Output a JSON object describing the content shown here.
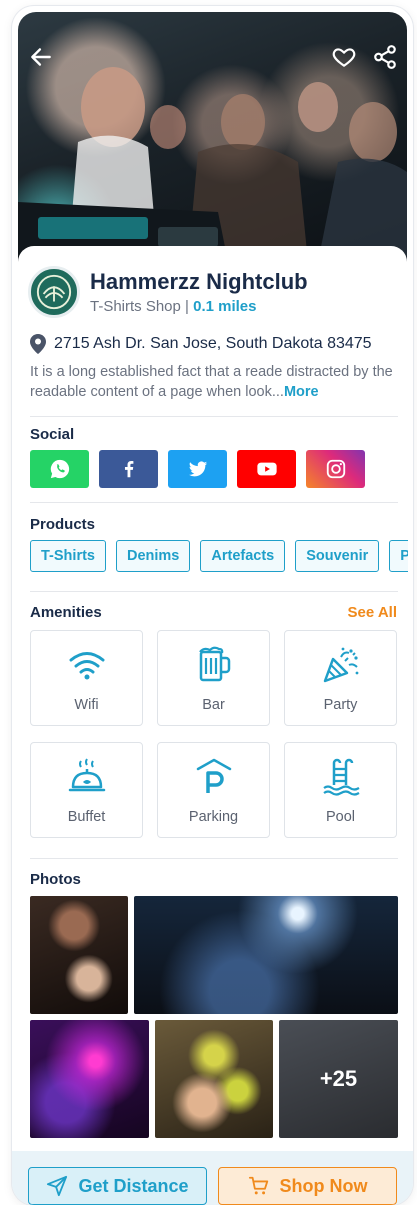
{
  "business": {
    "name": "Hammerzz Nightclub",
    "category": "T-Shirts Shop",
    "separator": " | ",
    "distance": "0.1 miles",
    "address": "2715 Ash Dr. San Jose, South Dakota 83475",
    "description": "It is a long established fact that a reade distracted by the readable content of a page when look...",
    "more_label": "More"
  },
  "social": {
    "label": "Social",
    "items": [
      {
        "name": "whatsapp",
        "color": "#25d366"
      },
      {
        "name": "facebook",
        "color": "#3b5998"
      },
      {
        "name": "twitter",
        "color": "#1da1f2"
      },
      {
        "name": "youtube",
        "color": "#ff0000"
      },
      {
        "name": "instagram",
        "color": "#e1306c"
      }
    ]
  },
  "products": {
    "label": "Products",
    "items": [
      "T-Shirts",
      "Denims",
      "Artefacts",
      "Souvenir",
      "P"
    ]
  },
  "amenities": {
    "label": "Amenities",
    "see_all": "See All",
    "items": [
      {
        "label": "Wifi",
        "icon": "wifi-icon"
      },
      {
        "label": "Bar",
        "icon": "beer-mug-icon"
      },
      {
        "label": "Party",
        "icon": "party-popper-icon"
      },
      {
        "label": "Buffet",
        "icon": "buffet-dish-icon"
      },
      {
        "label": "Parking",
        "icon": "parking-icon"
      },
      {
        "label": "Pool",
        "icon": "pool-ladder-icon"
      }
    ]
  },
  "photos": {
    "label": "Photos",
    "more_count": "+25"
  },
  "actions": {
    "get_distance": "Get Distance",
    "shop_now": "Shop Now"
  },
  "colors": {
    "accent": "#1f9fc9",
    "orange": "#f08a1c",
    "title": "#1a2b48"
  }
}
